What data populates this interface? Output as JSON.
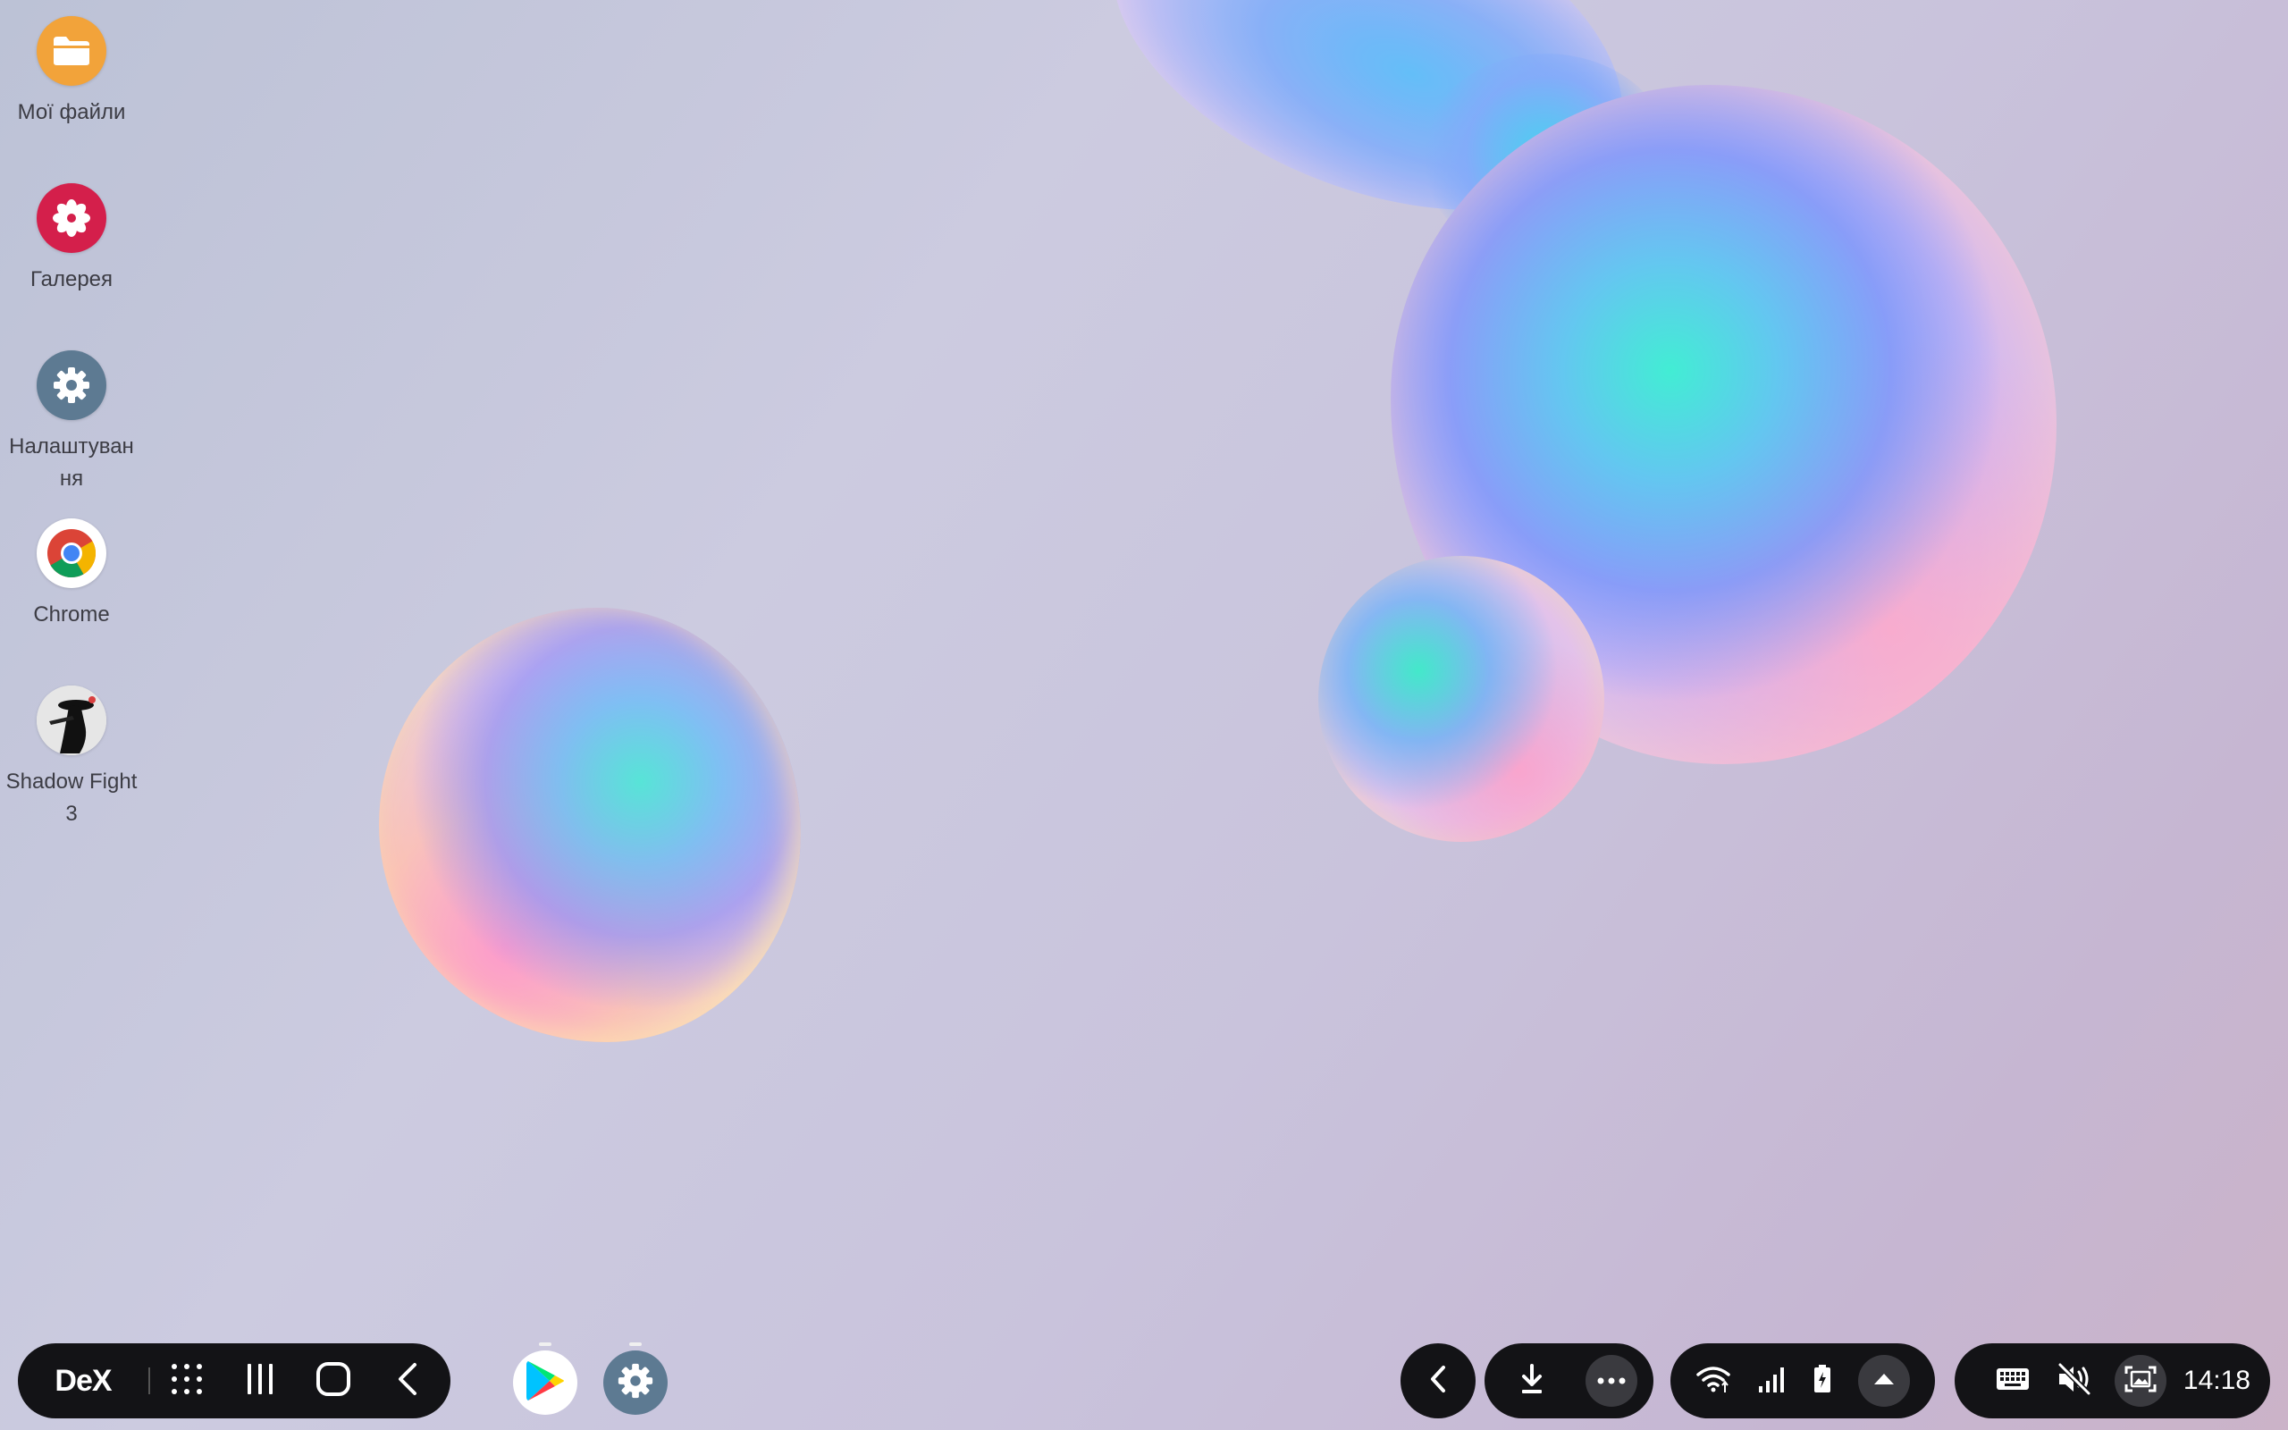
{
  "desktop": {
    "icons": [
      {
        "label": "Мої файли",
        "icon": "folder-icon",
        "color": "#f2a33a"
      },
      {
        "label": "Галерея",
        "icon": "flower-icon",
        "color": "#d41f4b"
      },
      {
        "label": "Налаштування",
        "icon": "gear-icon",
        "color": "#5d7a92"
      },
      {
        "label": "Chrome",
        "icon": "chrome-icon",
        "color": "#ffffff"
      },
      {
        "label": "Shadow Fight 3",
        "icon": "game-icon",
        "color": "#f0f0f0"
      }
    ]
  },
  "taskbar": {
    "left": {
      "dex_label": "DeX",
      "buttons": [
        "apps-grid-icon",
        "recent-apps-icon",
        "home-icon",
        "back-icon"
      ]
    },
    "dock_apps": [
      {
        "name": "Play Store",
        "icon": "play-store-icon"
      },
      {
        "name": "Settings",
        "icon": "gear-icon"
      }
    ],
    "right": {
      "quick_buttons": [
        "chevron-left-icon",
        "download-icon",
        "more-icon"
      ],
      "status_icons": [
        "wifi-icon",
        "signal-icon",
        "battery-icon",
        "caret-up-icon"
      ],
      "system_icons": [
        "keyboard-icon",
        "mute-icon",
        "screenshot-icon"
      ],
      "clock": "14:18"
    }
  },
  "colors": {
    "taskbar_bg": "#131316",
    "label_text": "#3c3c44"
  }
}
